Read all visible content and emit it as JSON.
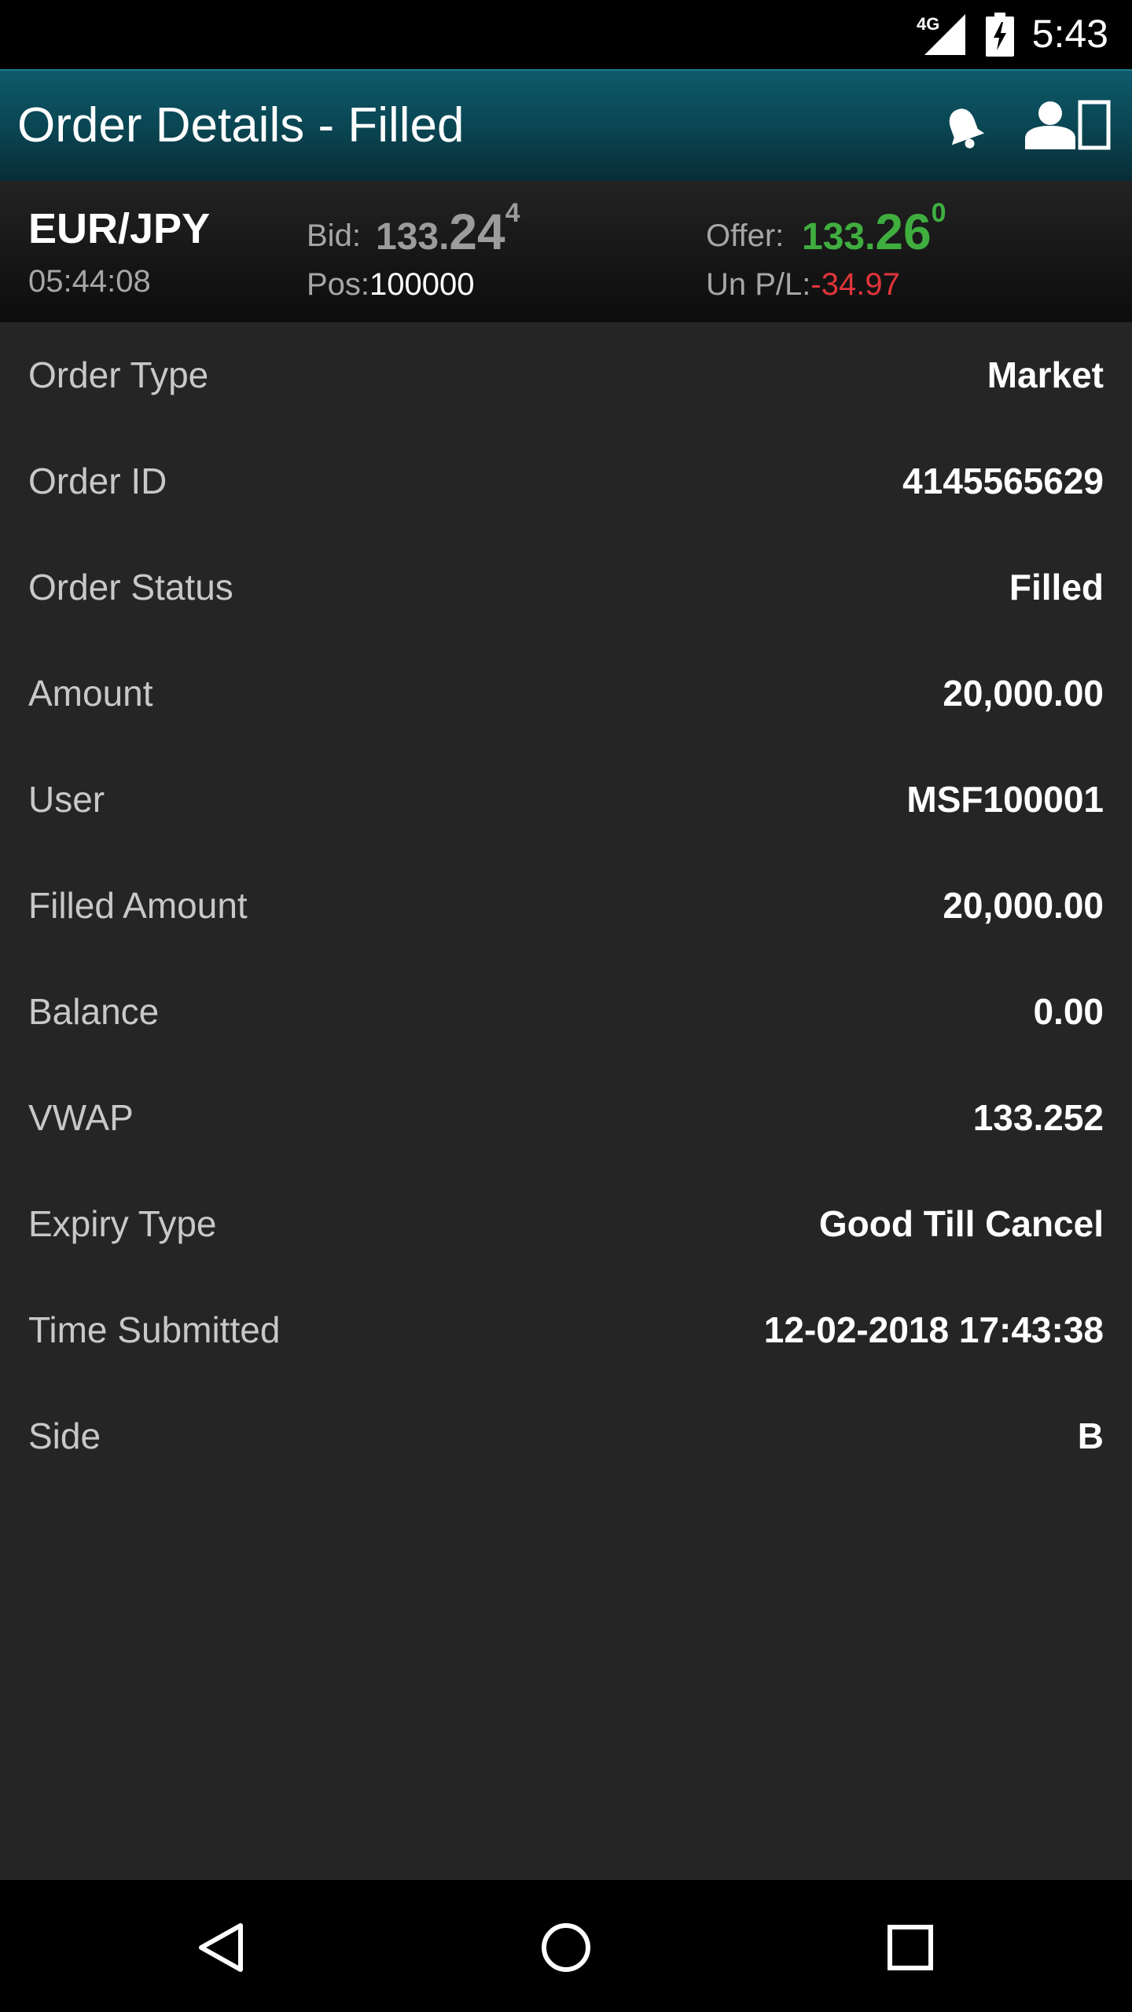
{
  "status_bar": {
    "network": "4G",
    "time": "5:43"
  },
  "app_bar": {
    "title": "Order Details - Filled",
    "icons": [
      "bell-icon",
      "account-icon"
    ]
  },
  "quote": {
    "pair": "EUR/JPY",
    "time": "05:44:08",
    "bid_label": "Bid:",
    "bid_main": "133.",
    "bid_big": "24",
    "bid_sup": "4",
    "pos_label": "Pos:",
    "pos_value": "100000",
    "offer_label": "Offer:",
    "offer_main": "133.",
    "offer_big": "26",
    "offer_sup": "0",
    "upl_label": "Un P/L:",
    "upl_value": "-34.97",
    "colors": {
      "offer": "#3fae3f",
      "upl_negative": "#e0353a",
      "bid": "#9c9c9c"
    }
  },
  "details": [
    {
      "label": "Order Type",
      "value": "Market"
    },
    {
      "label": "Order ID",
      "value": "4145565629"
    },
    {
      "label": "Order Status",
      "value": "Filled"
    },
    {
      "label": "Amount",
      "value": "20,000.00"
    },
    {
      "label": "User",
      "value": "MSF100001"
    },
    {
      "label": "Filled Amount",
      "value": "20,000.00"
    },
    {
      "label": "Balance",
      "value": "0.00"
    },
    {
      "label": "VWAP",
      "value": "133.252"
    },
    {
      "label": "Expiry Type",
      "value": "Good Till Cancel"
    },
    {
      "label": "Time Submitted",
      "value": "12-02-2018 17:43:38"
    },
    {
      "label": "Side",
      "value": "B"
    }
  ],
  "nav_bar": {
    "icons": [
      "back-icon",
      "home-icon",
      "recents-icon"
    ]
  }
}
